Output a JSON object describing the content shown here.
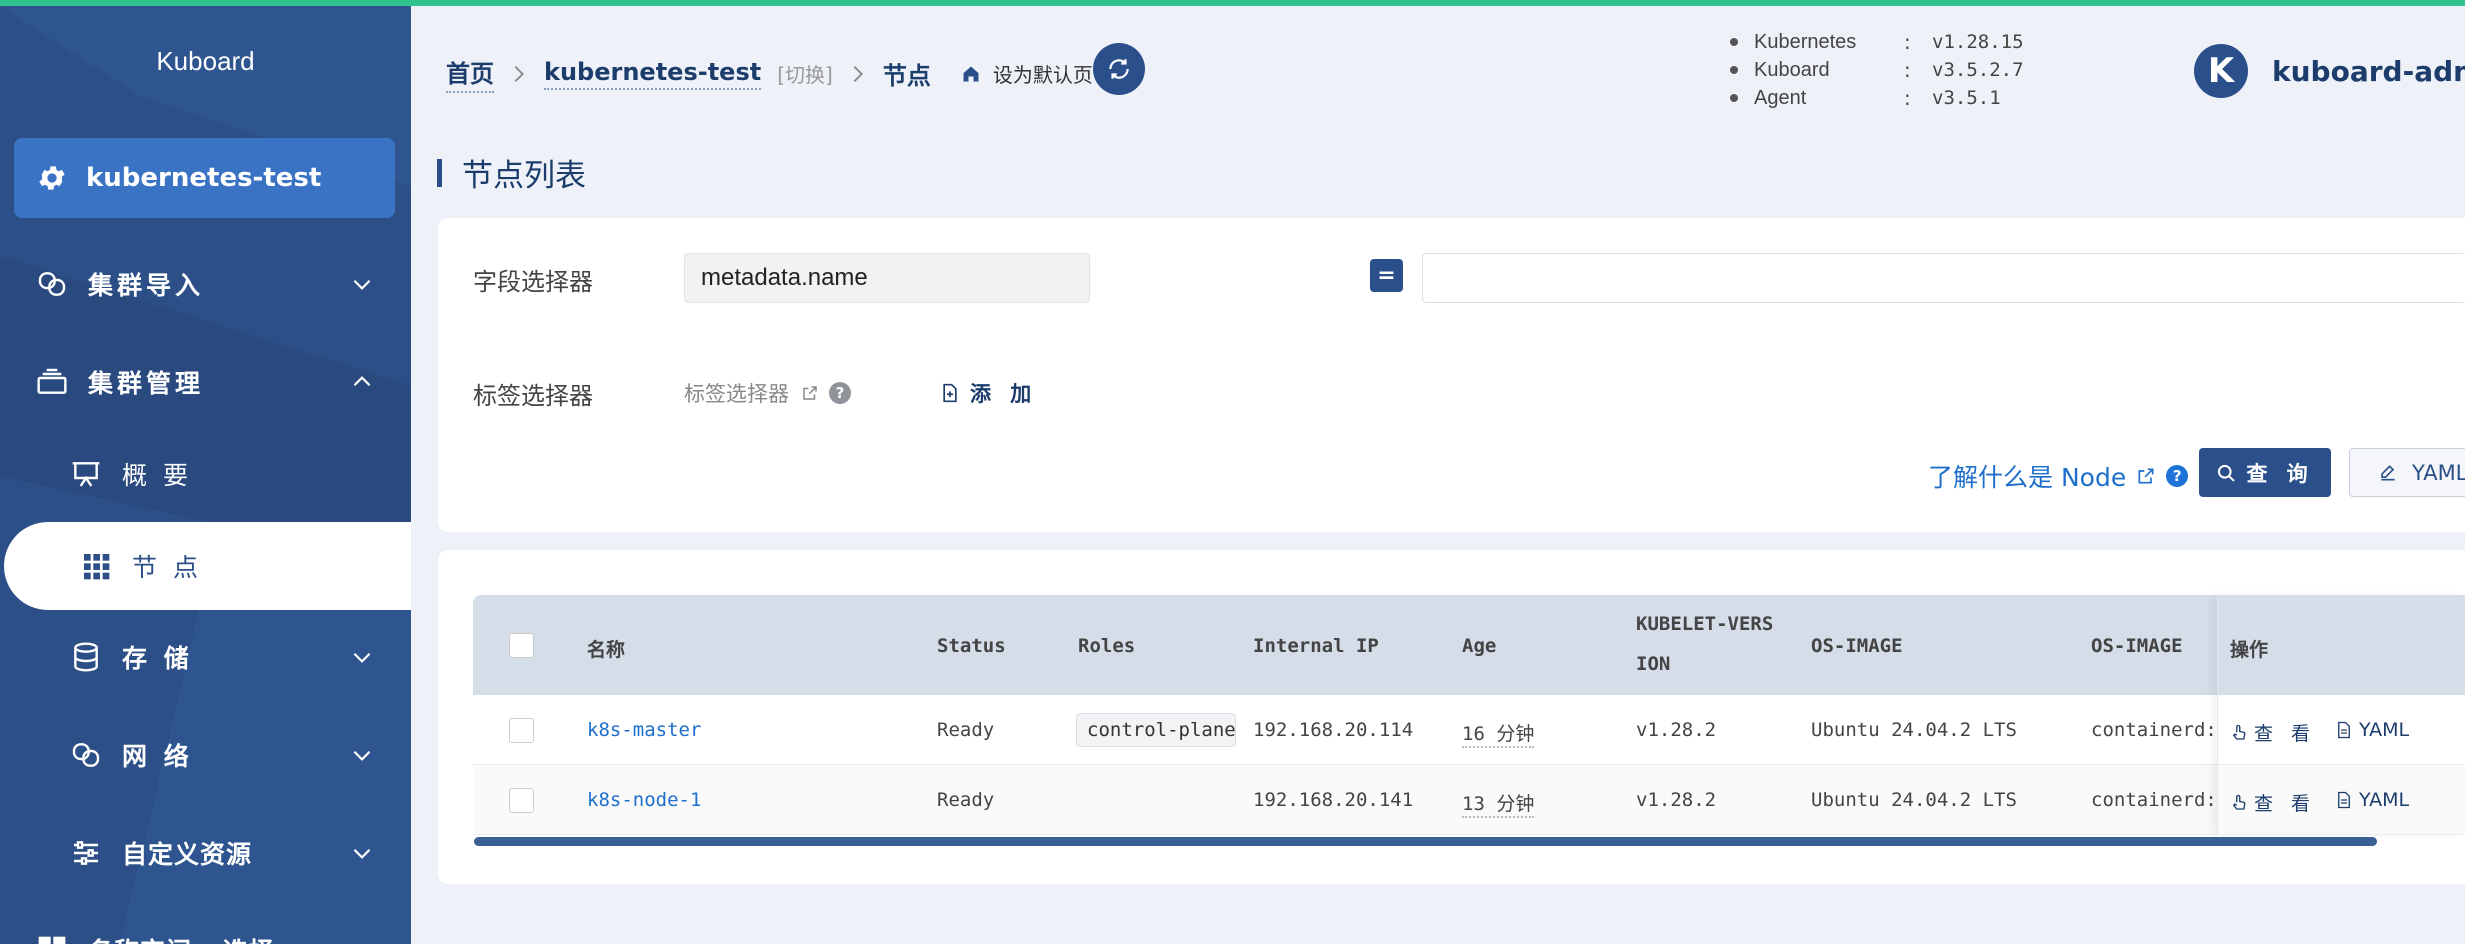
{
  "sidebar": {
    "brand": "Kuboard",
    "cluster": "kubernetes-test",
    "items": [
      {
        "label": "集群导入",
        "icon": "link-icon"
      },
      {
        "label": "集群管理",
        "icon": "layers-icon"
      },
      {
        "label": "概 要",
        "icon": "presentation-icon"
      },
      {
        "label": "节 点",
        "icon": "grid-icon"
      },
      {
        "label": "存 储",
        "icon": "database-icon"
      },
      {
        "label": "网 络",
        "icon": "link-icon"
      },
      {
        "label": "自定义资源",
        "icon": "sliders-icon"
      },
      {
        "label": "名称空间 - 选择",
        "icon": "grid-icon"
      }
    ]
  },
  "header": {
    "breadcrumb": {
      "home": "首页",
      "cluster": "kubernetes-test",
      "switch": "[切换]",
      "current": "节点",
      "set_default": "设为默认页"
    },
    "versions": [
      {
        "name": "Kubernetes",
        "sep": ":",
        "value": "v1.28.15"
      },
      {
        "name": "Kuboard",
        "sep": ":",
        "value": "v3.5.2.7"
      },
      {
        "name": "Agent",
        "sep": ":",
        "value": "v3.5.1"
      }
    ],
    "user": {
      "avatar_letter": "K",
      "name": "kuboard-admin"
    }
  },
  "page": {
    "title": "节点列表"
  },
  "filters": {
    "field_selector_label": "字段选择器",
    "field_selector_value": "metadata.name",
    "operator": "=",
    "field_value": "",
    "label_selector_label": "标签选择器",
    "label_selector_link": "标签选择器",
    "add_label": "添 加",
    "learn_link": "了解什么是 Node",
    "query_label": "查 询",
    "yaml_label": "YAML"
  },
  "table": {
    "headers": {
      "name": "名称",
      "status": "Status",
      "roles": "Roles",
      "internal_ip": "Internal IP",
      "age": "Age",
      "kubelet_line1": "KUBELET-VERS",
      "kubelet_line2": "ION",
      "os_image": "OS-IMAGE",
      "os_image_2": "OS-IMAGE",
      "actions": "操作"
    },
    "rows": [
      {
        "name": "k8s-master",
        "status": "Ready",
        "role": "control-plane",
        "ip": "192.168.20.114",
        "age": "16 分钟",
        "kubelet": "v1.28.2",
        "os": "Ubuntu 24.04.2 LTS",
        "runtime": "containerd:",
        "view": "查 看",
        "yaml": "YAML"
      },
      {
        "name": "k8s-node-1",
        "status": "Ready",
        "role": "",
        "ip": "192.168.20.141",
        "age": "13 分钟",
        "kubelet": "v1.28.2",
        "os": "Ubuntu 24.04.2 LTS",
        "runtime": "containerd:",
        "view": "查 看",
        "yaml": "YAML"
      }
    ]
  },
  "colors": {
    "primary": "#2a4f8a",
    "sidebar": "#2b4f86",
    "accent_line": "#2fc38f",
    "link": "#1e6fcc"
  }
}
